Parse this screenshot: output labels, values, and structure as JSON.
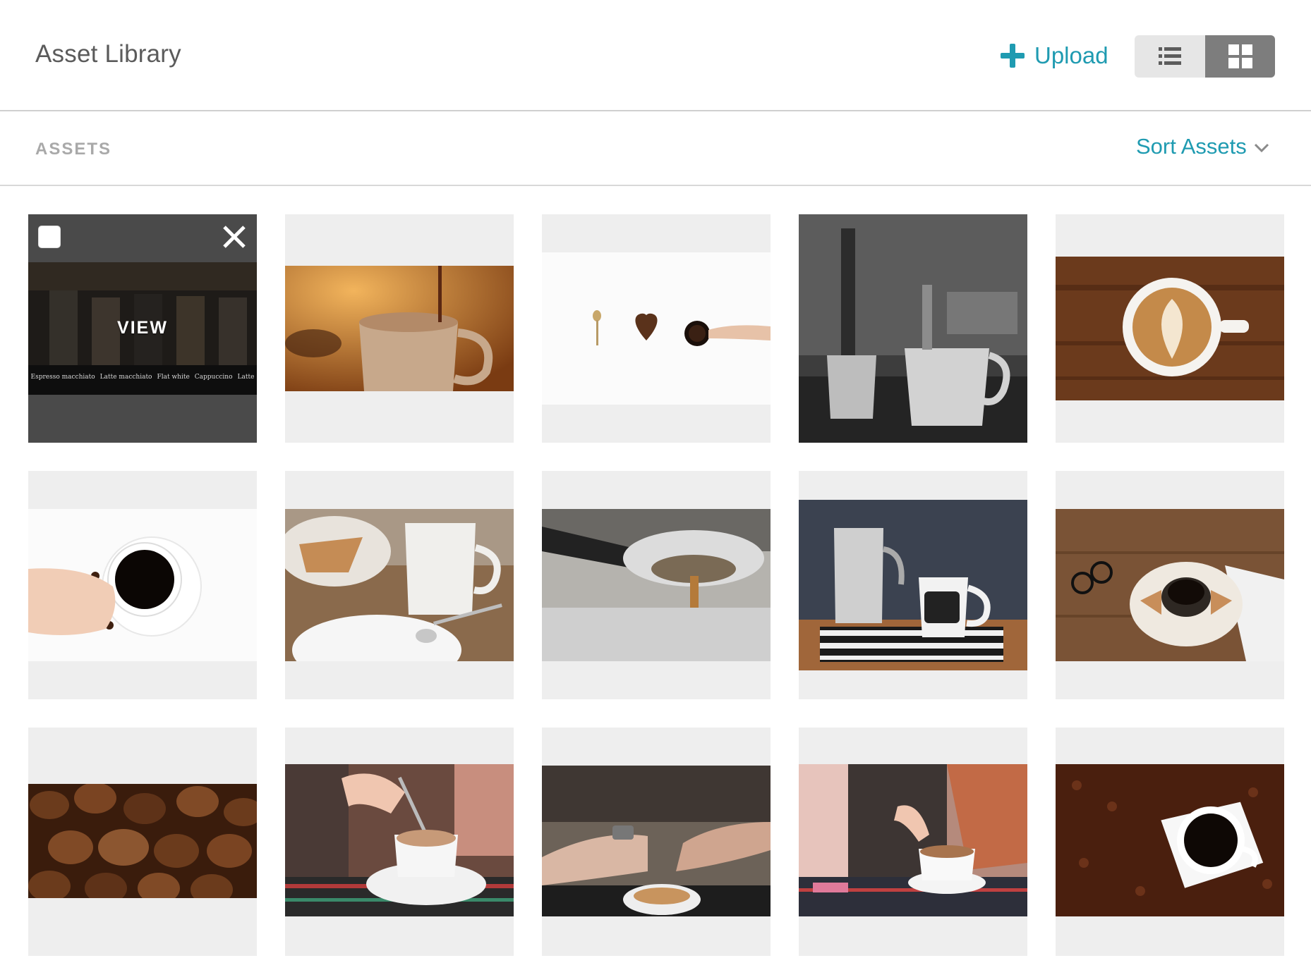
{
  "header": {
    "title": "Asset Library",
    "upload_label": "Upload",
    "view_modes": [
      "list",
      "grid"
    ],
    "active_view": "grid"
  },
  "toolbar": {
    "section_label": "ASSETS",
    "sort_label": "Sort Assets"
  },
  "assets": [
    {
      "id": 1,
      "subject": "coffee menu board",
      "selected": true,
      "hover_label": "VIEW",
      "menu_items": [
        "Espresso macchiato",
        "Latte macchiato",
        "Flat white",
        "Cappuccino",
        "Latte"
      ]
    },
    {
      "id": 2,
      "subject": "hot chocolate pour"
    },
    {
      "id": 3,
      "subject": "spoon heart coffee beans cup"
    },
    {
      "id": 4,
      "subject": "black and white cafe mugs"
    },
    {
      "id": 5,
      "subject": "latte art"
    },
    {
      "id": 6,
      "subject": "hand holding black coffee"
    },
    {
      "id": 7,
      "subject": "coffee break mug"
    },
    {
      "id": 8,
      "subject": "espresso machine pour"
    },
    {
      "id": 9,
      "subject": "moka pot and coffee mug"
    },
    {
      "id": 10,
      "subject": "glasses and espresso"
    },
    {
      "id": 11,
      "subject": "coffee beans closeup"
    },
    {
      "id": 12,
      "subject": "stirring cappuccino"
    },
    {
      "id": 13,
      "subject": "hands and coffee cup"
    },
    {
      "id": 14,
      "subject": "woman stirring coffee"
    },
    {
      "id": 15,
      "subject": "cup on coffee beans"
    }
  ],
  "colors": {
    "accent": "#1f9bb1",
    "selected_overlay": "#4a4a4a",
    "tile_bg": "#eeeeee"
  }
}
